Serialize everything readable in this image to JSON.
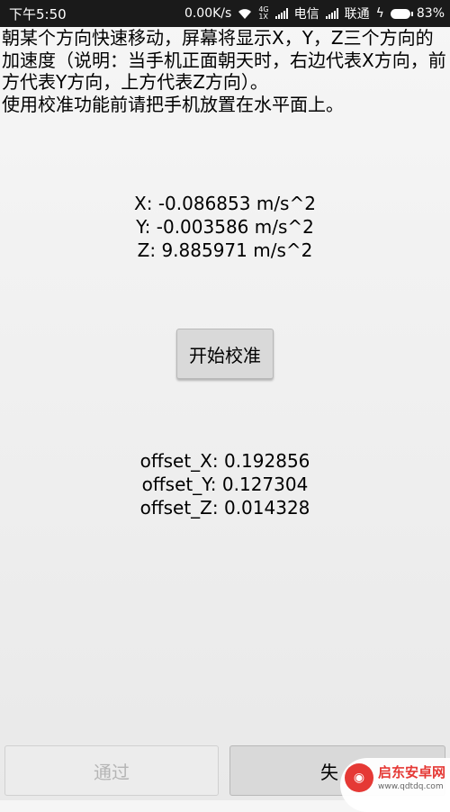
{
  "status_bar": {
    "time": "下午5:50",
    "speed": "0.00K/s",
    "net_4g_top": "4G",
    "net_4g_bottom": "1X",
    "carrier1": "电信",
    "carrier2": "联通",
    "battery": "83%"
  },
  "description": "朝某个方向快速移动，屏幕将显示X，Y，Z三个方向的加速度（说明：当手机正面朝天时，右边代表X方向，前方代表Y方向，上方代表Z方向）。\n使用校准功能前请把手机放置在水平面上。",
  "acceleration": {
    "x": "X: -0.086853 m/s^2",
    "y": "Y: -0.003586 m/s^2",
    "z": "Z: 9.885971 m/s^2"
  },
  "calibrate_label": "开始校准",
  "offsets": {
    "x": "offset_X: 0.192856",
    "y": "offset_Y: 0.127304",
    "z": "offset_Z: 0.014328"
  },
  "buttons": {
    "pass": "通过",
    "fail": "失"
  },
  "watermark": {
    "name": "启东安卓网",
    "url": "www.qdtdq.com"
  }
}
